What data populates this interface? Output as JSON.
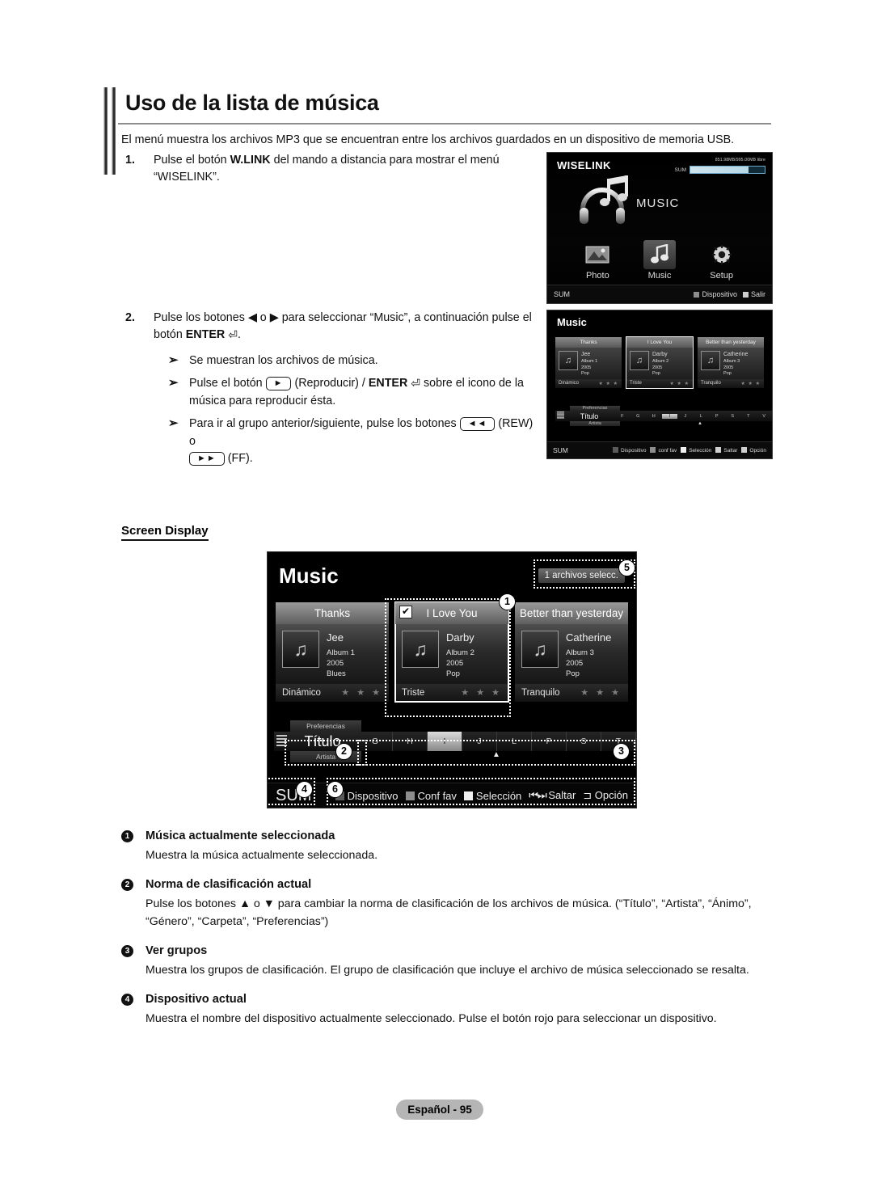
{
  "page": {
    "title": "Uso de la lista de música",
    "intro": "El menú muestra los archivos MP3 que se encuentran entre los archivos guardados en un dispositivo de memoria USB.",
    "footer_label": "Español - 95",
    "screen_display_heading": "Screen Display"
  },
  "steps": [
    {
      "num": "1.",
      "text_a": "Pulse el botón ",
      "bold_a": "W.LINK",
      "text_b": " del mando a distancia para mostrar el menú “WISELINK”."
    },
    {
      "num": "2.",
      "text_a": "Pulse los botones ◀ o ▶ para seleccionar “Music”, a continuación pulse el botón ",
      "bold_a": "ENTER",
      "text_b": ".",
      "substeps": [
        {
          "arrow": "➢",
          "text": "Se muestran los archivos de música."
        },
        {
          "arrow": "➢",
          "pre": "Pulse el botón ",
          "key": "►",
          "mid": " (Reproducir) / ",
          "bold": "ENTER",
          "post": " sobre el icono de la música para reproducir ésta."
        },
        {
          "arrow": "➢",
          "pre": "Para ir al grupo anterior/siguiente, pulse los botones ",
          "key": "◄◄",
          "mid": " (REW) o ",
          "key2": "►►",
          "post": " (FF)."
        }
      ]
    }
  ],
  "wiselink_screen": {
    "title": "WISELINK",
    "capacity_text": "851.98MB/995.00MB libre",
    "capacity_device": "SUM",
    "hero_label": "MUSIC",
    "icons": [
      {
        "label": "Photo",
        "icon": "photo-icon",
        "selected": false
      },
      {
        "label": "Music",
        "icon": "music-note-icon",
        "selected": true
      },
      {
        "label": "Setup",
        "icon": "gear-icon",
        "selected": false
      }
    ],
    "footer_device": "SUM",
    "footer_hints": [
      {
        "swatch": "#8d8d8d",
        "label": "Dispositivo"
      },
      {
        "swatch": "",
        "label": "Salir"
      }
    ]
  },
  "music_small_screen": {
    "title": "Music",
    "cards": [
      {
        "title": "Thanks",
        "artist": "Jee",
        "album": "Album 1",
        "year": "2005",
        "genre": "Pop",
        "mood": "Dinámico",
        "stars": "★ ★ ★",
        "selected": false,
        "checked": false
      },
      {
        "title": "I Love You",
        "artist": "Darby",
        "album": "Album 2",
        "year": "2005",
        "genre": "Pop",
        "mood": "Triste",
        "stars": "★ ★ ★",
        "selected": true,
        "checked": false
      },
      {
        "title": "Better than yesterday",
        "artist": "Catherine",
        "album": "Album 3",
        "year": "2005",
        "genre": "Pop",
        "mood": "Tranquilo",
        "stars": "★ ★ ★",
        "selected": false,
        "checked": false
      }
    ],
    "sort_above": "Preferencias",
    "sort_current": "Título",
    "sort_below": "Artista",
    "letters": [
      "F",
      "G",
      "H",
      "I",
      "J",
      "L",
      "P",
      "S",
      "T",
      "V"
    ],
    "letter_active": "I",
    "footer_device": "SUM",
    "footer_hints": [
      "Dispositivo",
      "conf fav",
      "Selección",
      "Saltar",
      "Opción"
    ]
  },
  "big_screen": {
    "title": "Music",
    "selected_badge": "1 archivos selecc.",
    "cards": [
      {
        "title": "Thanks",
        "artist": "Jee",
        "album": "Album 1",
        "year": "2005",
        "genre": "Blues",
        "mood": "Dinámico",
        "stars": "★ ★ ★",
        "selected": false,
        "checked": false
      },
      {
        "title": "I Love You",
        "artist": "Darby",
        "album": "Album 2",
        "year": "2005",
        "genre": "Pop",
        "mood": "Triste",
        "stars": "★ ★ ★",
        "selected": true,
        "checked": true
      },
      {
        "title": "Better than yesterday",
        "artist": "Catherine",
        "album": "Album 3",
        "year": "2005",
        "genre": "Pop",
        "mood": "Tranquilo",
        "stars": "★ ★ ★",
        "selected": false,
        "checked": false
      }
    ],
    "sort_above": "Preferencias",
    "sort_current": "Título",
    "sort_below": "Artista",
    "letters": [
      "G",
      "H",
      "I",
      "J",
      "L",
      "P",
      "S",
      "T"
    ],
    "letter_active": "I",
    "footer_device": "SUM",
    "footer_hints": [
      {
        "swatch": "#5a5a5a",
        "label": "Dispositivo"
      },
      {
        "swatch": "#8d8d8d",
        "label": "Conf fav"
      },
      {
        "swatch": "#f0f0f0",
        "label": "Selección"
      },
      {
        "swatch": "",
        "label": "Saltar"
      },
      {
        "swatch": "",
        "label": "Opción"
      }
    ],
    "callouts": [
      "1",
      "2",
      "3",
      "4",
      "5",
      "6"
    ]
  },
  "legend": [
    {
      "num": "❶",
      "num_plain": "1",
      "title": "Música actualmente seleccionada",
      "desc": "Muestra la música actualmente seleccionada."
    },
    {
      "num": "❷",
      "num_plain": "2",
      "title": "Norma de clasificación actual",
      "desc": "Pulse los botones ▲ o ▼ para cambiar la norma de clasificación de los archivos de música. (“Título”, “Artista”, “Ánimo”, “Género”, “Carpeta”, “Preferencias”)"
    },
    {
      "num": "❸",
      "num_plain": "3",
      "title": "Ver grupos",
      "desc": "Muestra los grupos de clasificación. El grupo de clasificación que incluye el archivo de música seleccionado se resalta."
    },
    {
      "num": "❹",
      "num_plain": "4",
      "title": "Dispositivo actual",
      "desc": "Muestra el nombre del dispositivo actualmente seleccionado. Pulse el botón rojo para seleccionar un dispositivo."
    }
  ]
}
